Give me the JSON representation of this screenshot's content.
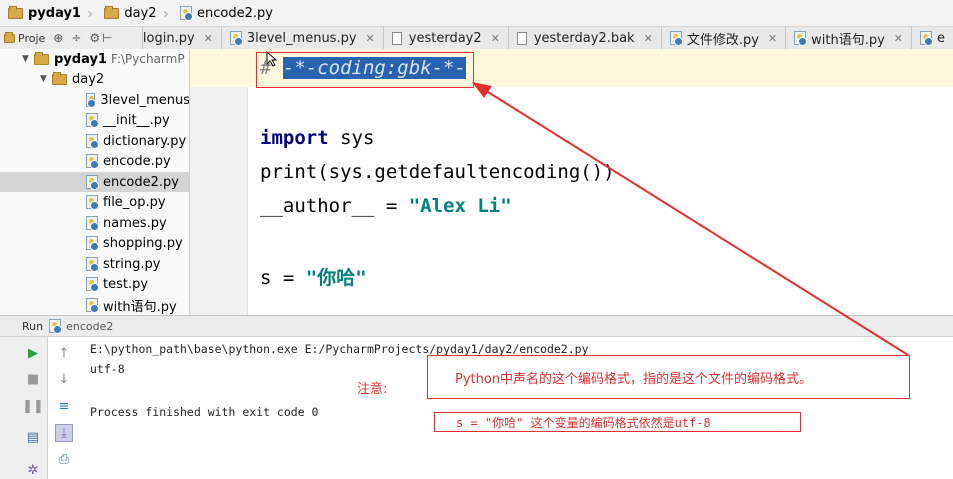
{
  "breadcrumb": [
    "pyday1",
    "day2",
    "encode2.py"
  ],
  "project_panel": {
    "label": "Proje"
  },
  "tabs": [
    {
      "label": "login.py"
    },
    {
      "label": "3level_menus.py"
    },
    {
      "label": "yesterday2"
    },
    {
      "label": "yesterday2.bak"
    },
    {
      "label": "文件修改.py"
    },
    {
      "label": "with语句.py"
    },
    {
      "label": "e"
    }
  ],
  "tree": {
    "root": {
      "label": "pyday1",
      "path": "F:\\PycharmP"
    },
    "folder": {
      "label": "day2"
    },
    "files": [
      "3level_menus",
      "__init__.py",
      "dictionary.py",
      "encode.py",
      "encode2.py",
      "file_op.py",
      "names.py",
      "shopping.py",
      "string.py",
      "test.py",
      "with语句.py"
    ],
    "selected": "encode2.py"
  },
  "code": {
    "line1_hash": "#",
    "line1_comment": "-*-coding:gbk-*-",
    "line3_kw": "import",
    "line3_rest": " sys",
    "line4": "print(sys.getdefaultencoding())",
    "line5_a": "__author__ = ",
    "line5_str": "\"Alex Li\"",
    "line7_a": "s = ",
    "line7_str": "\"你哈\""
  },
  "run": {
    "title": "Run",
    "config": "encode2",
    "output": [
      "E:\\python_path\\base\\python.exe E:/PycharmProjects/pyday1/day2/encode2.py",
      "utf-8",
      "",
      "Process finished with exit code 0"
    ]
  },
  "annotations": {
    "label": "注意:",
    "note1": "Python中声名的这个编码格式，指的是这个文件的编码格式。",
    "note2": "s = \"你哈\" 这个变量的编码格式依然是utf-8"
  },
  "colors": {
    "annotation": "#e03030",
    "selection": "#2962b0",
    "keyword": "#000080",
    "string": "#008080"
  }
}
